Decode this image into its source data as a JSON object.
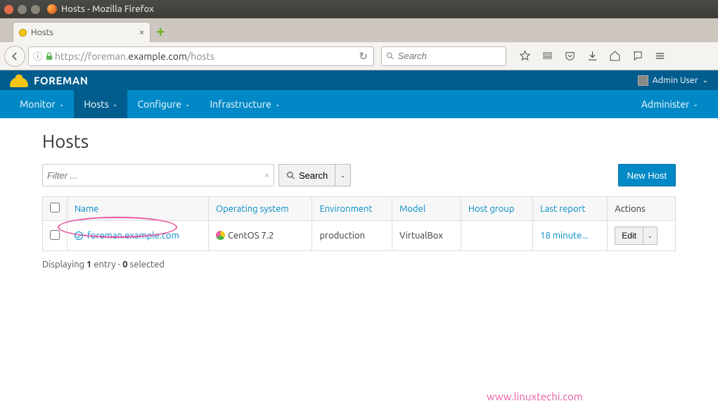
{
  "window": {
    "title": "Hosts - Mozilla Firefox"
  },
  "tab": {
    "title": "Hosts"
  },
  "browser": {
    "url_scheme": "https://",
    "url_prefix": "foreman.",
    "url_bold": "example.com",
    "url_suffix": "/hosts",
    "search_placeholder": "Search"
  },
  "brand": {
    "name": "FOREMAN",
    "user": "Admin User"
  },
  "nav": {
    "monitor": "Monitor",
    "hosts": "Hosts",
    "configure": "Configure",
    "infrastructure": "Infrastructure",
    "administer": "Administer"
  },
  "page": {
    "title": "Hosts",
    "filter_placeholder": "Filter ...",
    "search_label": "Search",
    "new_host_label": "New Host"
  },
  "table": {
    "headers": {
      "name": "Name",
      "os": "Operating system",
      "env": "Environment",
      "model": "Model",
      "hostgroup": "Host group",
      "lastreport": "Last report",
      "actions": "Actions"
    },
    "rows": [
      {
        "name": "foreman.example.com",
        "os": "CentOS 7.2",
        "env": "production",
        "model": "VirtualBox",
        "hostgroup": "",
        "lastreport": "18 minute...",
        "edit": "Edit"
      }
    ]
  },
  "summary": {
    "prefix": "Displaying ",
    "count": "1",
    "mid": " entry - ",
    "selected": "0",
    "suffix": " selected"
  },
  "watermark": "www.linuxtechi.com"
}
